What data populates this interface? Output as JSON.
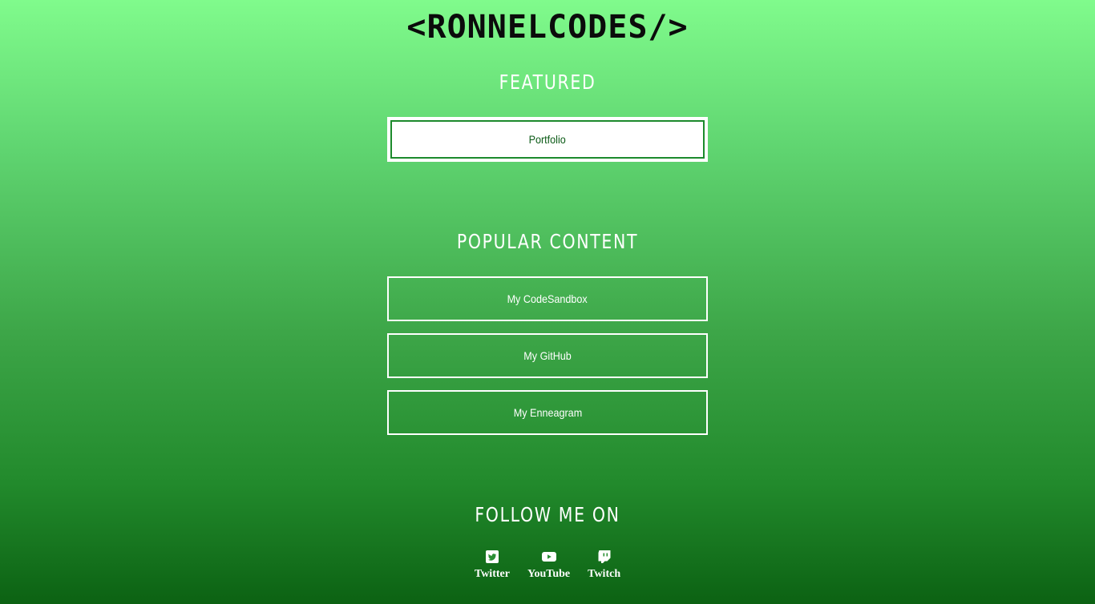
{
  "header": {
    "logo_text": "<RONNELCODES/>"
  },
  "featured": {
    "title": "FEATURED",
    "links": [
      {
        "label": "Portfolio"
      }
    ]
  },
  "popular": {
    "title": "POPULAR CONTENT",
    "links": [
      {
        "label": "My CodeSandbox"
      },
      {
        "label": "My GitHub"
      },
      {
        "label": "My Enneagram"
      }
    ]
  },
  "follow": {
    "title": "FOLLOW ME ON",
    "items": [
      {
        "label": "Twitter",
        "icon": "twitter-icon"
      },
      {
        "label": "YouTube",
        "icon": "youtube-icon"
      },
      {
        "label": "Twitch",
        "icon": "twitch-icon"
      }
    ]
  },
  "colors": {
    "gradient_top": "#80fb8c",
    "gradient_bottom": "#0c6213",
    "featured_text": "#0b5a16",
    "text": "#ffffff"
  }
}
